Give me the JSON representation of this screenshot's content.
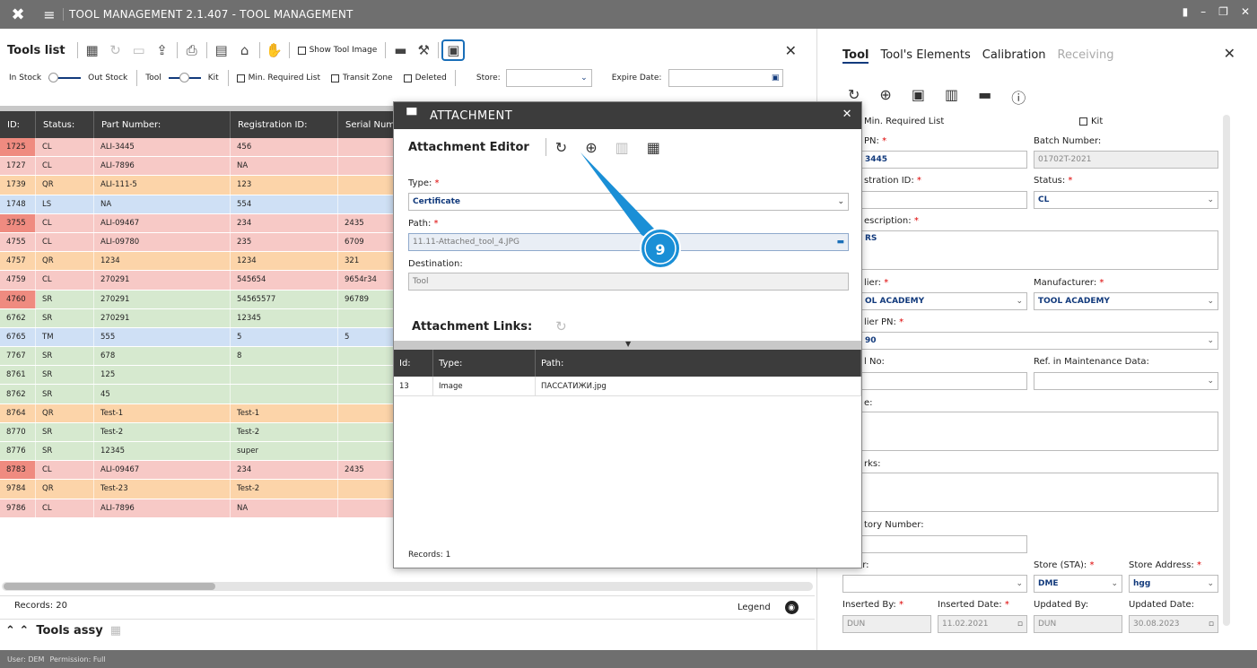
{
  "app": {
    "title": "TOOL MANAGEMENT 2.1.407 - TOOL MANAGEMENT"
  },
  "status": {
    "user": "User: DEM",
    "permission": "Permission: Full"
  },
  "tools_list": {
    "title": "Tools list",
    "show_image_label": "Show Tool Image",
    "in_stock": "In Stock",
    "out_stock": "Out Stock",
    "tool": "Tool",
    "kit": "Kit",
    "min_required": "Min. Required List",
    "transit_zone": "Transit Zone",
    "deleted": "Deleted",
    "store": "Store:",
    "expire_date": "Expire Date:",
    "columns": [
      "ID:",
      "Status:",
      "Part Number:",
      "Registration ID:",
      "Serial Num"
    ],
    "rows": [
      {
        "id": "1725",
        "status": "CL",
        "pn": "ALI-3445",
        "reg": "456",
        "serial": "",
        "color": "pink",
        "idcolor": "red"
      },
      {
        "id": "1727",
        "status": "CL",
        "pn": "ALI-7896",
        "reg": "NA",
        "serial": "",
        "color": "pink",
        "idcolor": "pink"
      },
      {
        "id": "1739",
        "status": "QR",
        "pn": "ALI-111-5",
        "reg": "123",
        "serial": "",
        "color": "orange",
        "idcolor": "orange"
      },
      {
        "id": "1748",
        "status": "LS",
        "pn": "NA",
        "reg": "554",
        "serial": "",
        "color": "blue",
        "idcolor": "blue"
      },
      {
        "id": "3755",
        "status": "CL",
        "pn": "ALI-09467",
        "reg": "234",
        "serial": "2435",
        "color": "pink",
        "idcolor": "red"
      },
      {
        "id": "4755",
        "status": "CL",
        "pn": "ALI-09780",
        "reg": "235",
        "serial": "6709",
        "color": "pink",
        "idcolor": "pink"
      },
      {
        "id": "4757",
        "status": "QR",
        "pn": "1234",
        "reg": "1234",
        "serial": "321",
        "color": "orange",
        "idcolor": "orange"
      },
      {
        "id": "4759",
        "status": "CL",
        "pn": "270291",
        "reg": "545654",
        "serial": "9654r34",
        "color": "pink",
        "idcolor": "pink"
      },
      {
        "id": "4760",
        "status": "SR",
        "pn": "270291",
        "reg": "54565577",
        "serial": "96789",
        "color": "green",
        "idcolor": "red"
      },
      {
        "id": "6762",
        "status": "SR",
        "pn": "270291",
        "reg": "12345",
        "serial": "",
        "color": "green",
        "idcolor": "green"
      },
      {
        "id": "6765",
        "status": "TM",
        "pn": "555",
        "reg": "5",
        "serial": "5",
        "color": "blue",
        "idcolor": "blue"
      },
      {
        "id": "7767",
        "status": "SR",
        "pn": "678",
        "reg": "8",
        "serial": "",
        "color": "green",
        "idcolor": "green"
      },
      {
        "id": "8761",
        "status": "SR",
        "pn": "125",
        "reg": "",
        "serial": "",
        "color": "green",
        "idcolor": "green"
      },
      {
        "id": "8762",
        "status": "SR",
        "pn": "45",
        "reg": "",
        "serial": "",
        "color": "green",
        "idcolor": "green"
      },
      {
        "id": "8764",
        "status": "QR",
        "pn": "Test-1",
        "reg": "Test-1",
        "serial": "",
        "color": "orange",
        "idcolor": "orange"
      },
      {
        "id": "8770",
        "status": "SR",
        "pn": "Test-2",
        "reg": "Test-2",
        "serial": "",
        "color": "green",
        "idcolor": "green"
      },
      {
        "id": "8776",
        "status": "SR",
        "pn": "12345",
        "reg": "super",
        "serial": "",
        "color": "green",
        "idcolor": "green"
      },
      {
        "id": "8783",
        "status": "CL",
        "pn": "ALI-09467",
        "reg": "234",
        "serial": "2435",
        "color": "pink",
        "idcolor": "red"
      },
      {
        "id": "9784",
        "status": "QR",
        "pn": "Test-23",
        "reg": "Test-2",
        "serial": "",
        "color": "orange",
        "idcolor": "orange"
      },
      {
        "id": "9786",
        "status": "CL",
        "pn": "ALI-7896",
        "reg": "NA",
        "serial": "",
        "color": "pink",
        "idcolor": "pink"
      }
    ],
    "records": "Records: 20",
    "legend": "Legend",
    "assy": "Tools assy"
  },
  "right_panel": {
    "tabs": [
      "Tool",
      "Tool's Elements",
      "Calibration",
      "Receiving"
    ],
    "min_required": "Min. Required List",
    "kit": "Kit",
    "pn_label": "PN:",
    "pn_value": "3445",
    "batch_label": "Batch Number:",
    "batch_value": "01702T-2021",
    "reg_label": "stration ID:",
    "status_label": "Status:",
    "status_value": "CL",
    "desc_label": "escription:",
    "desc_value": "RS",
    "supplier_label": "lier:",
    "supplier_value": "OL ACADEMY",
    "manufacturer_label": "Manufacturer:",
    "manufacturer_value": "TOOL ACADEMY",
    "supplier_pn_label": "lier PN:",
    "supplier_pn_value": "90",
    "serial_label": "l No:",
    "ref_label": "Ref. in Maintenance Data:",
    "note_label": "e:",
    "remarks_label": "rks:",
    "inventory_label": "tory Number:",
    "owner_label": "er:",
    "store_sta_label": "Store (STA):",
    "store_sta_value": "DME",
    "store_address_label": "Store Address:",
    "store_address_value": "hgg",
    "inserted_by_label": "Inserted By:",
    "inserted_by_value": "DUN",
    "inserted_date_label": "Inserted Date:",
    "inserted_date_value": "11.02.2021",
    "updated_by_label": "Updated By:",
    "updated_by_value": "DUN",
    "updated_date_label": "Updated Date:",
    "updated_date_value": "30.08.2023"
  },
  "dialog": {
    "title": "ATTACHMENT",
    "editor_title": "Attachment Editor",
    "type_label": "Type:",
    "type_value": "Certificate",
    "path_label": "Path:",
    "path_value": "11.11-Attached_tool_4.JPG",
    "destination_label": "Destination:",
    "destination_value": "Tool",
    "links_title": "Attachment Links:",
    "columns": [
      "Id:",
      "Type:",
      "Path:"
    ],
    "rows": [
      {
        "id": "13",
        "type": "Image",
        "path": "ПАССАТИЖИ.jpg"
      }
    ],
    "records": "Records: 1"
  },
  "callout": {
    "number": "9",
    "color": "#1a8fd6"
  }
}
